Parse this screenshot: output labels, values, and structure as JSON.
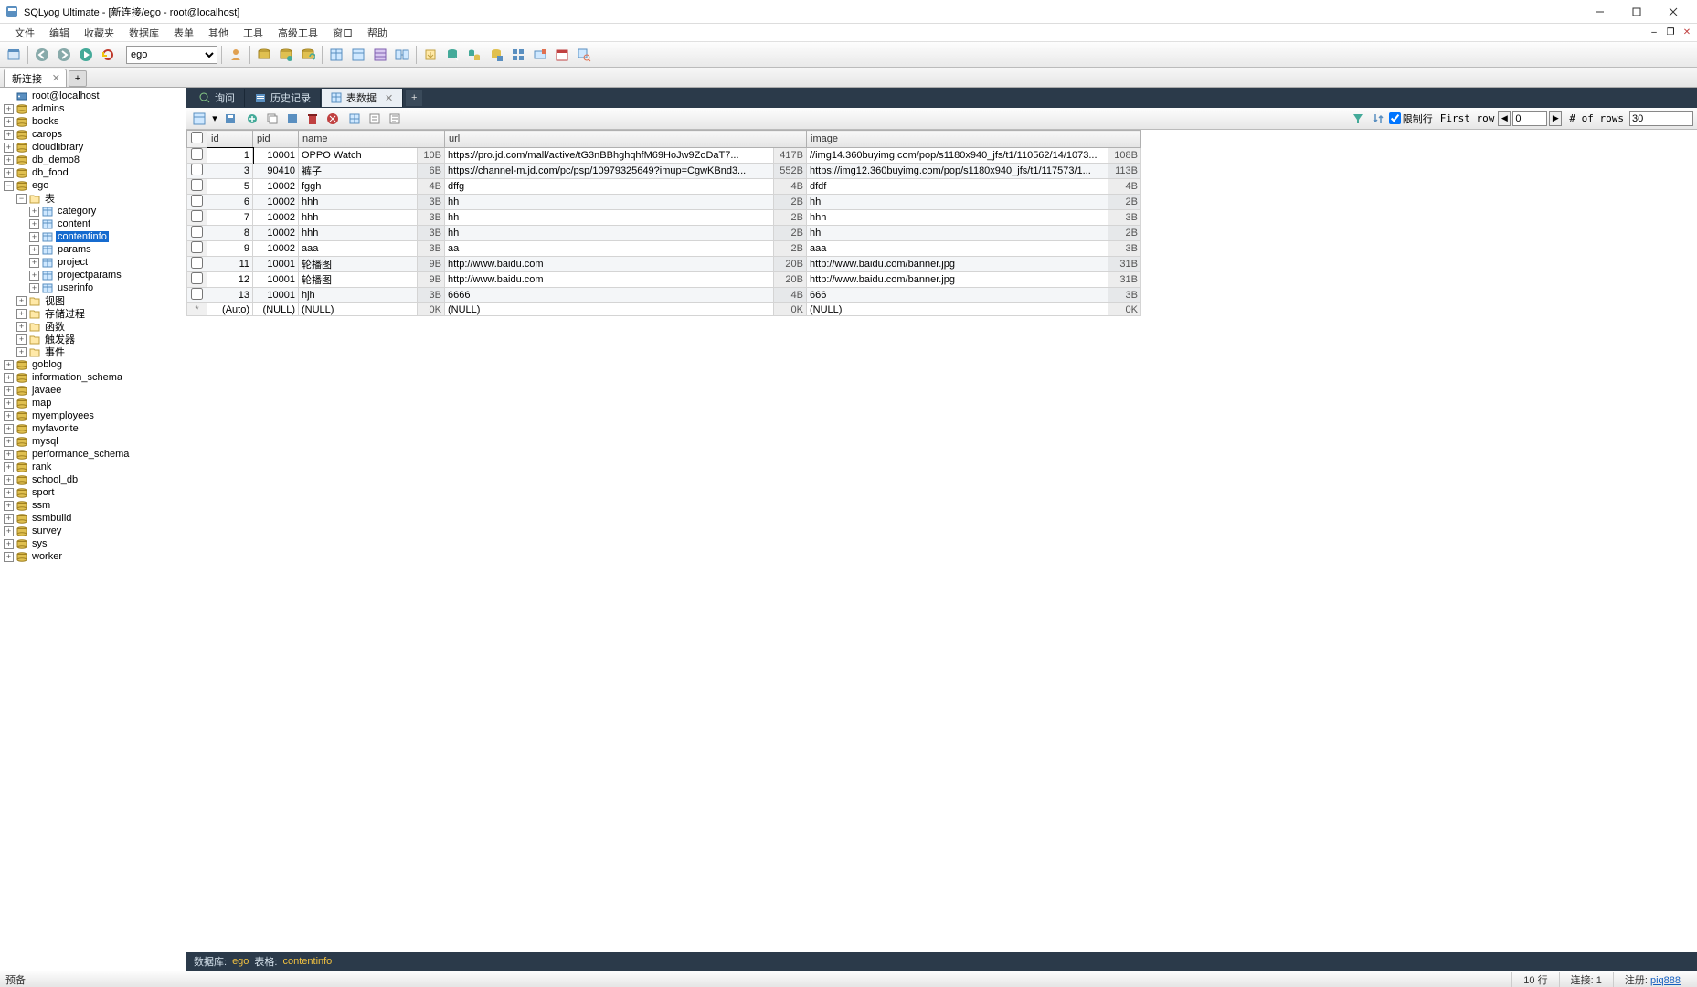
{
  "app_title": "SQLyog Ultimate - [新连接/ego - root@localhost]",
  "menu": [
    "文件",
    "编辑",
    "收藏夹",
    "数据库",
    "表单",
    "其他",
    "工具",
    "高级工具",
    "窗口",
    "帮助"
  ],
  "db_combo": "ego",
  "conn_tab": "新连接",
  "tree_root": "root@localhost",
  "databases": [
    "admins",
    "books",
    "carops",
    "cloudlibrary",
    "db_demo8",
    "db_food"
  ],
  "ego_tables_label": "表",
  "ego_subfolders": [
    "视图",
    "存储过程",
    "函数",
    "触发器",
    "事件"
  ],
  "ego_tables": [
    "category",
    "content",
    "contentinfo",
    "params",
    "project",
    "projectparams",
    "userinfo"
  ],
  "selected_table": "contentinfo",
  "databases_after": [
    "goblog",
    "information_schema",
    "javaee",
    "map",
    "myemployees",
    "myfavorite",
    "mysql",
    "performance_schema",
    "rank",
    "school_db",
    "sport",
    "ssm",
    "ssmbuild",
    "survey",
    "sys",
    "worker"
  ],
  "result_tabs": [
    {
      "icon": "query",
      "label": "询问"
    },
    {
      "icon": "history",
      "label": "历史记录"
    },
    {
      "icon": "data",
      "label": "表数据",
      "active": true,
      "closable": true
    }
  ],
  "limit_label": "限制行",
  "first_row_label": "First row",
  "first_row_value": "0",
  "num_rows_label": "# of rows",
  "num_rows_value": "30",
  "columns": [
    "id",
    "pid",
    "name",
    "url",
    "image"
  ],
  "rows": [
    {
      "id": "1",
      "pid": "10001",
      "name": "OPPO Watch",
      "name_s": "10B",
      "url": "https://pro.jd.com/mall/active/tG3nBBhghqhfM69HoJw9ZoDaT7...",
      "url_s": "417B",
      "image": "//img14.360buyimg.com/pop/s1180x940_jfs/t1/110562/14/1073...",
      "image_s": "108B"
    },
    {
      "id": "3",
      "pid": "90410",
      "name": "裤子",
      "name_s": "6B",
      "url": "https://channel-m.jd.com/pc/psp/10979325649?imup=CgwKBnd3...",
      "url_s": "552B",
      "image": "https://img12.360buyimg.com/pop/s1180x940_jfs/t1/117573/1...",
      "image_s": "113B"
    },
    {
      "id": "5",
      "pid": "10002",
      "name": "fggh",
      "name_s": "4B",
      "url": "dffg",
      "url_s": "4B",
      "image": "dfdf",
      "image_s": "4B"
    },
    {
      "id": "6",
      "pid": "10002",
      "name": "hhh",
      "name_s": "3B",
      "url": "hh",
      "url_s": "2B",
      "image": "hh",
      "image_s": "2B"
    },
    {
      "id": "7",
      "pid": "10002",
      "name": "hhh",
      "name_s": "3B",
      "url": "hh",
      "url_s": "2B",
      "image": "hhh",
      "image_s": "3B"
    },
    {
      "id": "8",
      "pid": "10002",
      "name": "hhh",
      "name_s": "3B",
      "url": "hh",
      "url_s": "2B",
      "image": "hh",
      "image_s": "2B"
    },
    {
      "id": "9",
      "pid": "10002",
      "name": "aaa",
      "name_s": "3B",
      "url": "aa",
      "url_s": "2B",
      "image": "aaa",
      "image_s": "3B"
    },
    {
      "id": "11",
      "pid": "10001",
      "name": "轮播图",
      "name_s": "9B",
      "url": "http://www.baidu.com",
      "url_s": "20B",
      "image": "http://www.baidu.com/banner.jpg",
      "image_s": "31B"
    },
    {
      "id": "12",
      "pid": "10001",
      "name": "轮播图",
      "name_s": "9B",
      "url": "http://www.baidu.com",
      "url_s": "20B",
      "image": "http://www.baidu.com/banner.jpg",
      "image_s": "31B"
    },
    {
      "id": "13",
      "pid": "10001",
      "name": "hjh",
      "name_s": "3B",
      "url": "6666",
      "url_s": "4B",
      "image": "666",
      "image_s": "3B"
    }
  ],
  "auto_row": {
    "id": "(Auto)",
    "pid": "(NULL)",
    "name": "(NULL)",
    "name_s": "0K",
    "url": "(NULL)",
    "url_s": "0K",
    "image": "(NULL)",
    "image_s": "0K"
  },
  "info_db_label": "数据库:",
  "info_db": "ego",
  "info_tbl_label": "表格:",
  "info_tbl": "contentinfo",
  "status_ready": "预备",
  "status_rows": "10 行",
  "status_conn": "连接: 1",
  "status_reg_label": "注册:",
  "status_reg": "piq888"
}
